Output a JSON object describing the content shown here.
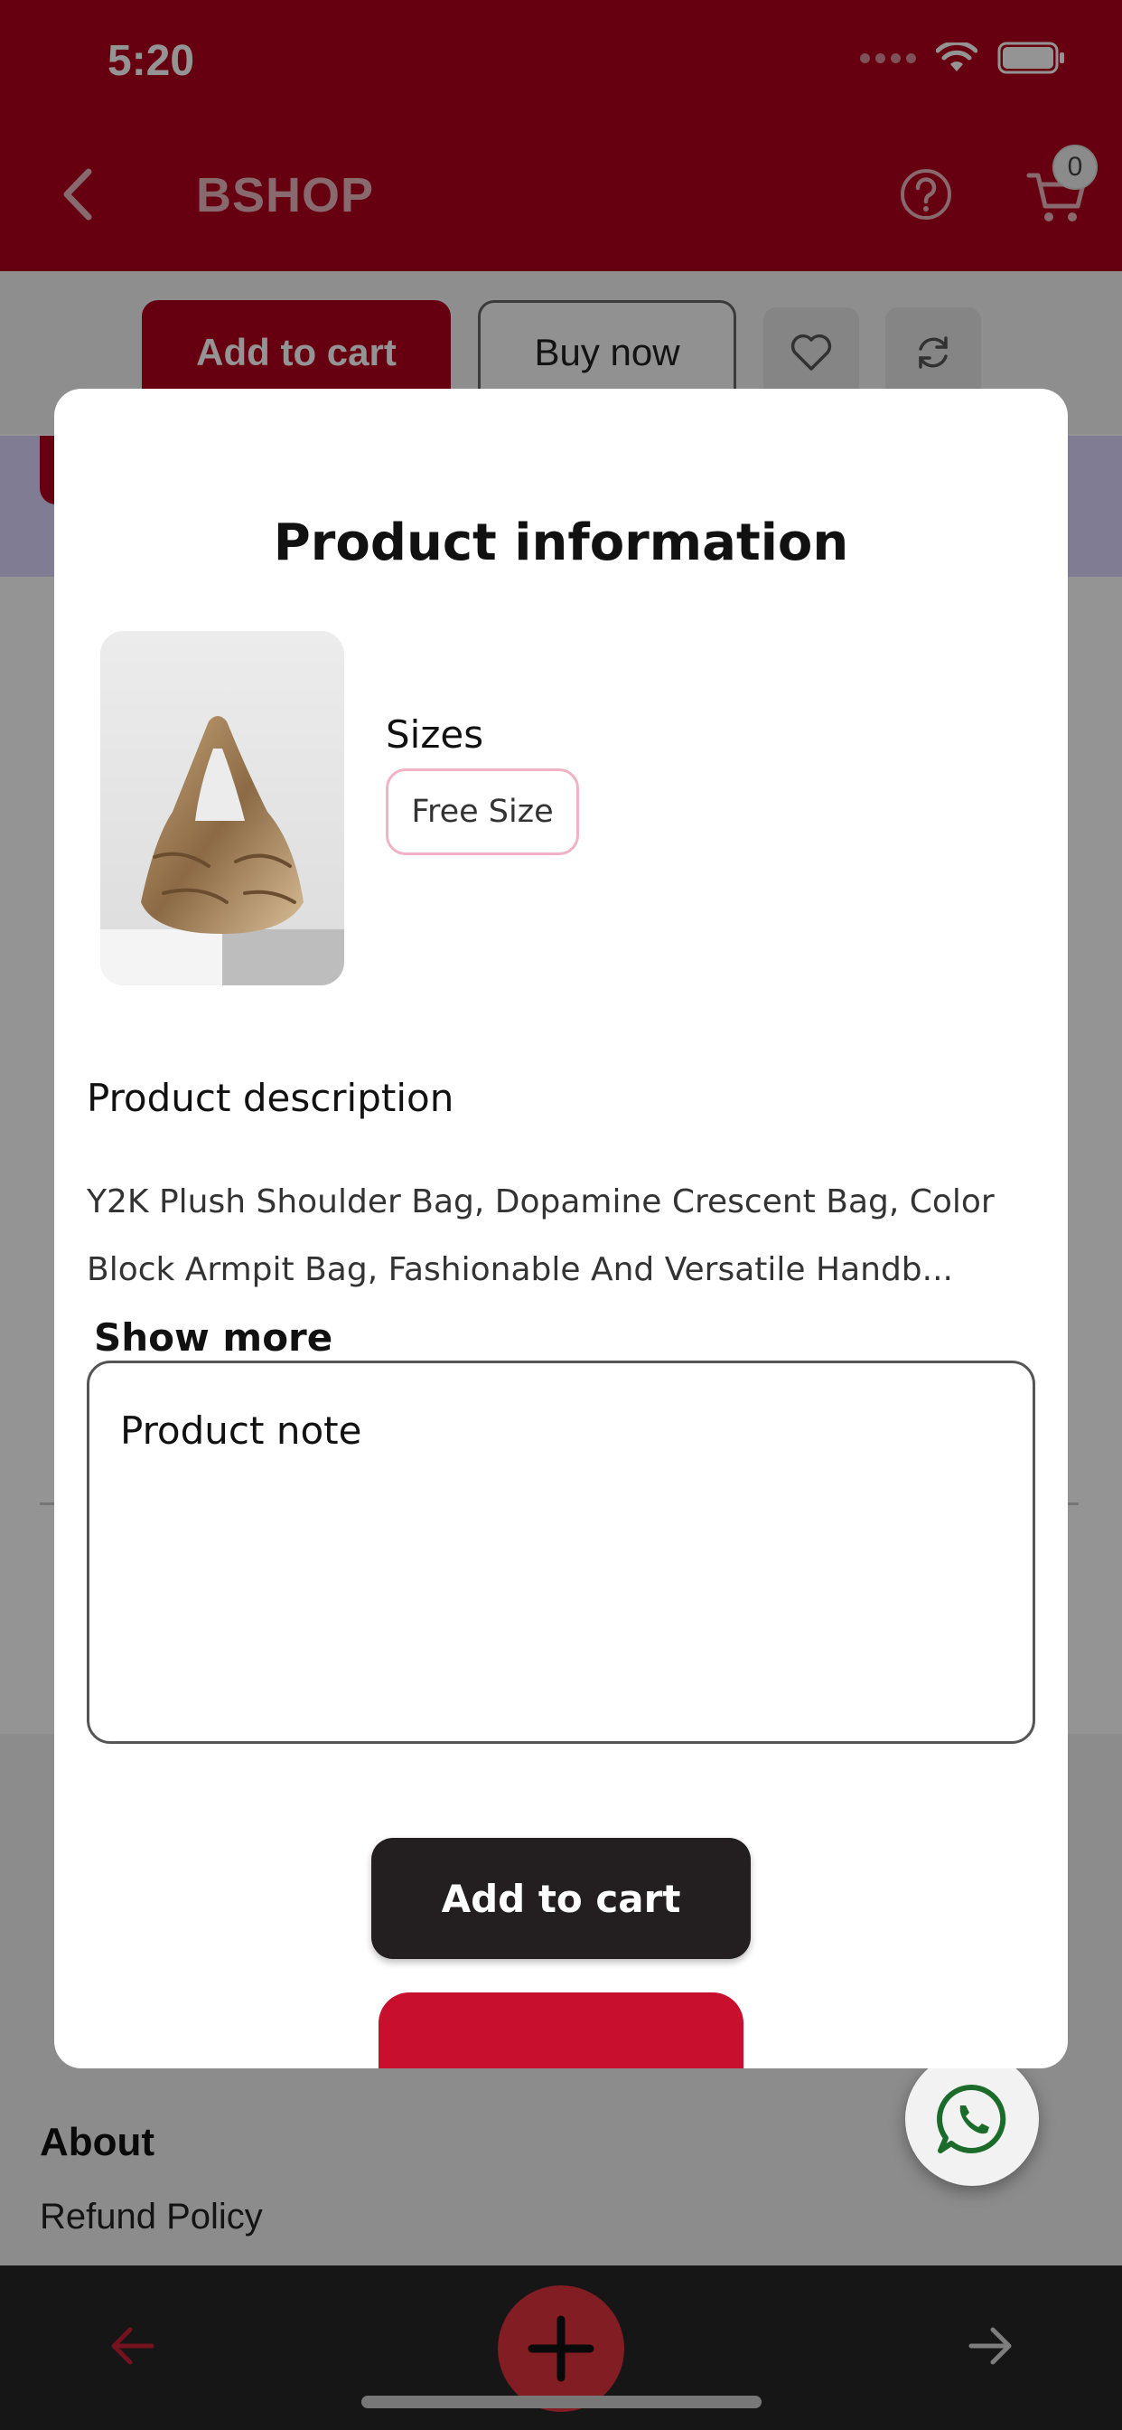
{
  "status_bar": {
    "time": "5:20"
  },
  "header": {
    "brand": "BSHOP",
    "cart_count": "0"
  },
  "page": {
    "add_to_cart": "Add to cart",
    "buy_now": "Buy now",
    "about_title": "About",
    "refund_policy": "Refund Policy"
  },
  "modal": {
    "title": "Product information",
    "sizes_label": "Sizes",
    "size_option": "Free Size",
    "description_heading": "Product description",
    "description_text": "Y2K Plush Shoulder Bag, Dopamine Crescent Bag, Color Block Armpit Bag, Fashionable And Versatile Handb...",
    "show_more": "Show more",
    "note_placeholder": "Product note",
    "add_to_cart": "Add to cart"
  },
  "colors": {
    "brand_red": "#b0001c",
    "chip_border": "#f2b2c6",
    "dark_button": "#231f20",
    "bottom_bar": "#262626"
  }
}
